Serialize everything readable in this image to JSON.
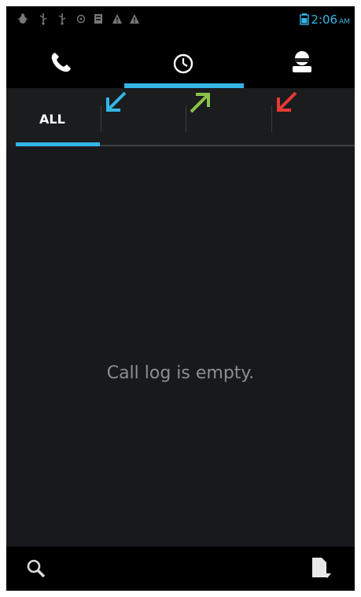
{
  "status_bar": {
    "time": "2:06",
    "ampm": "AM",
    "icons": [
      "bug-icon",
      "usb-icon",
      "usb-icon",
      "sync-icon",
      "sd-card-icon",
      "warning-icon",
      "warning-icon",
      "battery-icon"
    ],
    "accent": "#33b5e5"
  },
  "tabs": {
    "items": [
      {
        "name": "phone-icon",
        "selected": false
      },
      {
        "name": "clock-icon",
        "selected": true
      },
      {
        "name": "contacts-icon",
        "selected": false
      }
    ]
  },
  "filters": {
    "all_label": "ALL",
    "items": [
      {
        "name": "all",
        "selected": true
      },
      {
        "name": "incoming-arrow-icon",
        "color": "#33b5e5"
      },
      {
        "name": "outgoing-arrow-icon",
        "color": "#8bc34a"
      },
      {
        "name": "missed-arrow-icon",
        "color": "#e53935"
      }
    ]
  },
  "content": {
    "empty_message": "Call log is empty."
  },
  "bottom_bar": {
    "items": [
      "search-icon",
      "menu-icon"
    ]
  }
}
